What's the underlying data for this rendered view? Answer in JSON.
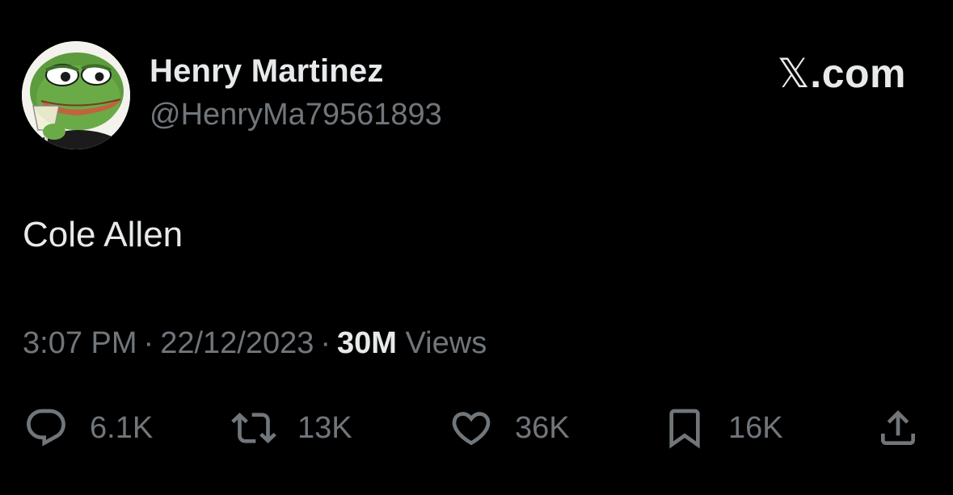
{
  "author": {
    "display_name": "Henry Martinez",
    "handle": "@HenryMa79561893",
    "avatar_icon": "pepe-frog-avatar"
  },
  "brand": {
    "glyph": "𝕏",
    "suffix": ".com"
  },
  "tweet": {
    "text": "Cole Allen"
  },
  "meta": {
    "time": "3:07 PM",
    "date": "22/12/2023",
    "separator": "·",
    "views_count": "30M",
    "views_label": "Views"
  },
  "actions": {
    "reply": {
      "icon": "reply-icon",
      "count": "6.1K"
    },
    "repost": {
      "icon": "repost-icon",
      "count": "13K"
    },
    "like": {
      "icon": "heart-icon",
      "count": "36K"
    },
    "bookmark": {
      "icon": "bookmark-icon",
      "count": "16K"
    },
    "share": {
      "icon": "share-icon"
    }
  },
  "colors": {
    "background": "#000000",
    "primary_text": "#e7e9ea",
    "secondary_text": "#71767b"
  }
}
